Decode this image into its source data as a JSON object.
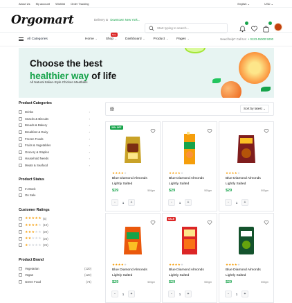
{
  "topbar": {
    "links": [
      "About Us",
      "My account",
      "Wishlist",
      "Order Tracking"
    ],
    "language": "English",
    "currency": "USD"
  },
  "header": {
    "logo": "Orgomart",
    "deliver_label": "Delivery to",
    "deliver_location": "Downtown New York...",
    "search_placeholder": "Start typing to search..."
  },
  "nav": {
    "all_categories": "All Categories",
    "items": [
      {
        "label": "Home",
        "chevron": "⌄"
      },
      {
        "label": "Shop",
        "chevron": "⌄",
        "badge": "New"
      },
      {
        "label": "Dashboard",
        "chevron": "⌄"
      },
      {
        "label": "Product",
        "chevron": "⌄"
      },
      {
        "label": "Pages",
        "chevron": "⌄"
      }
    ],
    "help_label": "Need help? Call Us:",
    "help_phone": "+ 0123 45000 5000"
  },
  "banner": {
    "title_line1": "Choose the best",
    "title_green": "healthier way",
    "title_rest": " of life",
    "subtitle": "All Natural Italian-Style Chicken Meatballs"
  },
  "sidebar": {
    "categories_title": "Product Categories",
    "categories": [
      "Drinks",
      "Snacks & Biscuits",
      "Breads & Bakery",
      "Breakfast & Dairy",
      "Frozen Foods",
      "Fruits & Vegetables",
      "Grocery & Staples",
      "Household Needs",
      "Meats & Seafood"
    ],
    "status_title": "Product Status",
    "status": [
      "In Stock",
      "On Sale"
    ],
    "ratings_title": "Customer Ratings",
    "ratings": [
      {
        "stars": 5,
        "count": "(5)"
      },
      {
        "stars": 4,
        "count": "(10)"
      },
      {
        "stars": 3,
        "count": "(20)"
      },
      {
        "stars": 2,
        "count": "(25)"
      },
      {
        "stars": 1,
        "count": "(26)"
      }
    ],
    "brand_title": "Product Brand",
    "brands": [
      {
        "name": "Vegetarian",
        "count": "(120)"
      },
      {
        "name": "Vegan",
        "count": "(120)"
      },
      {
        "name": "Green Food",
        "count": "(74)"
      }
    ]
  },
  "toolbar": {
    "sort_label": "Sort by latest"
  },
  "products": [
    {
      "tag": "30% OFF",
      "tag_color": "#16a34a",
      "name": "Blue Diamond Almonds Lightly Salted",
      "price": "$29",
      "weight": "500gm",
      "qty": "1",
      "rating": 4,
      "img": "bag-gold"
    },
    {
      "tag": "",
      "name": "Blue Diamond Almonds Lightly Salted",
      "price": "$29",
      "weight": "500gm",
      "qty": "1",
      "rating": 4,
      "img": "juice-box"
    },
    {
      "tag": "",
      "name": "Blue Diamond Almonds Lightly Salted",
      "price": "$29",
      "weight": "500gm",
      "qty": "1",
      "rating": 4,
      "img": "bag-red"
    },
    {
      "tag": "",
      "name": "Blue Diamond Almonds Lightly Salted",
      "price": "$29",
      "weight": "500gm",
      "qty": "1",
      "rating": 4,
      "img": "pack-orange"
    },
    {
      "tag": "SALE",
      "tag_color": "#dc2626",
      "name": "Blue Diamond Almonds Lightly Salted",
      "price": "$29",
      "weight": "500gm",
      "qty": "1",
      "rating": 4,
      "img": "pack-red"
    },
    {
      "tag": "",
      "name": "Blue Diamond Almonds Lightly Salted",
      "price": "$29",
      "weight": "500gm",
      "qty": "1",
      "rating": 4,
      "img": "pack-green"
    }
  ]
}
